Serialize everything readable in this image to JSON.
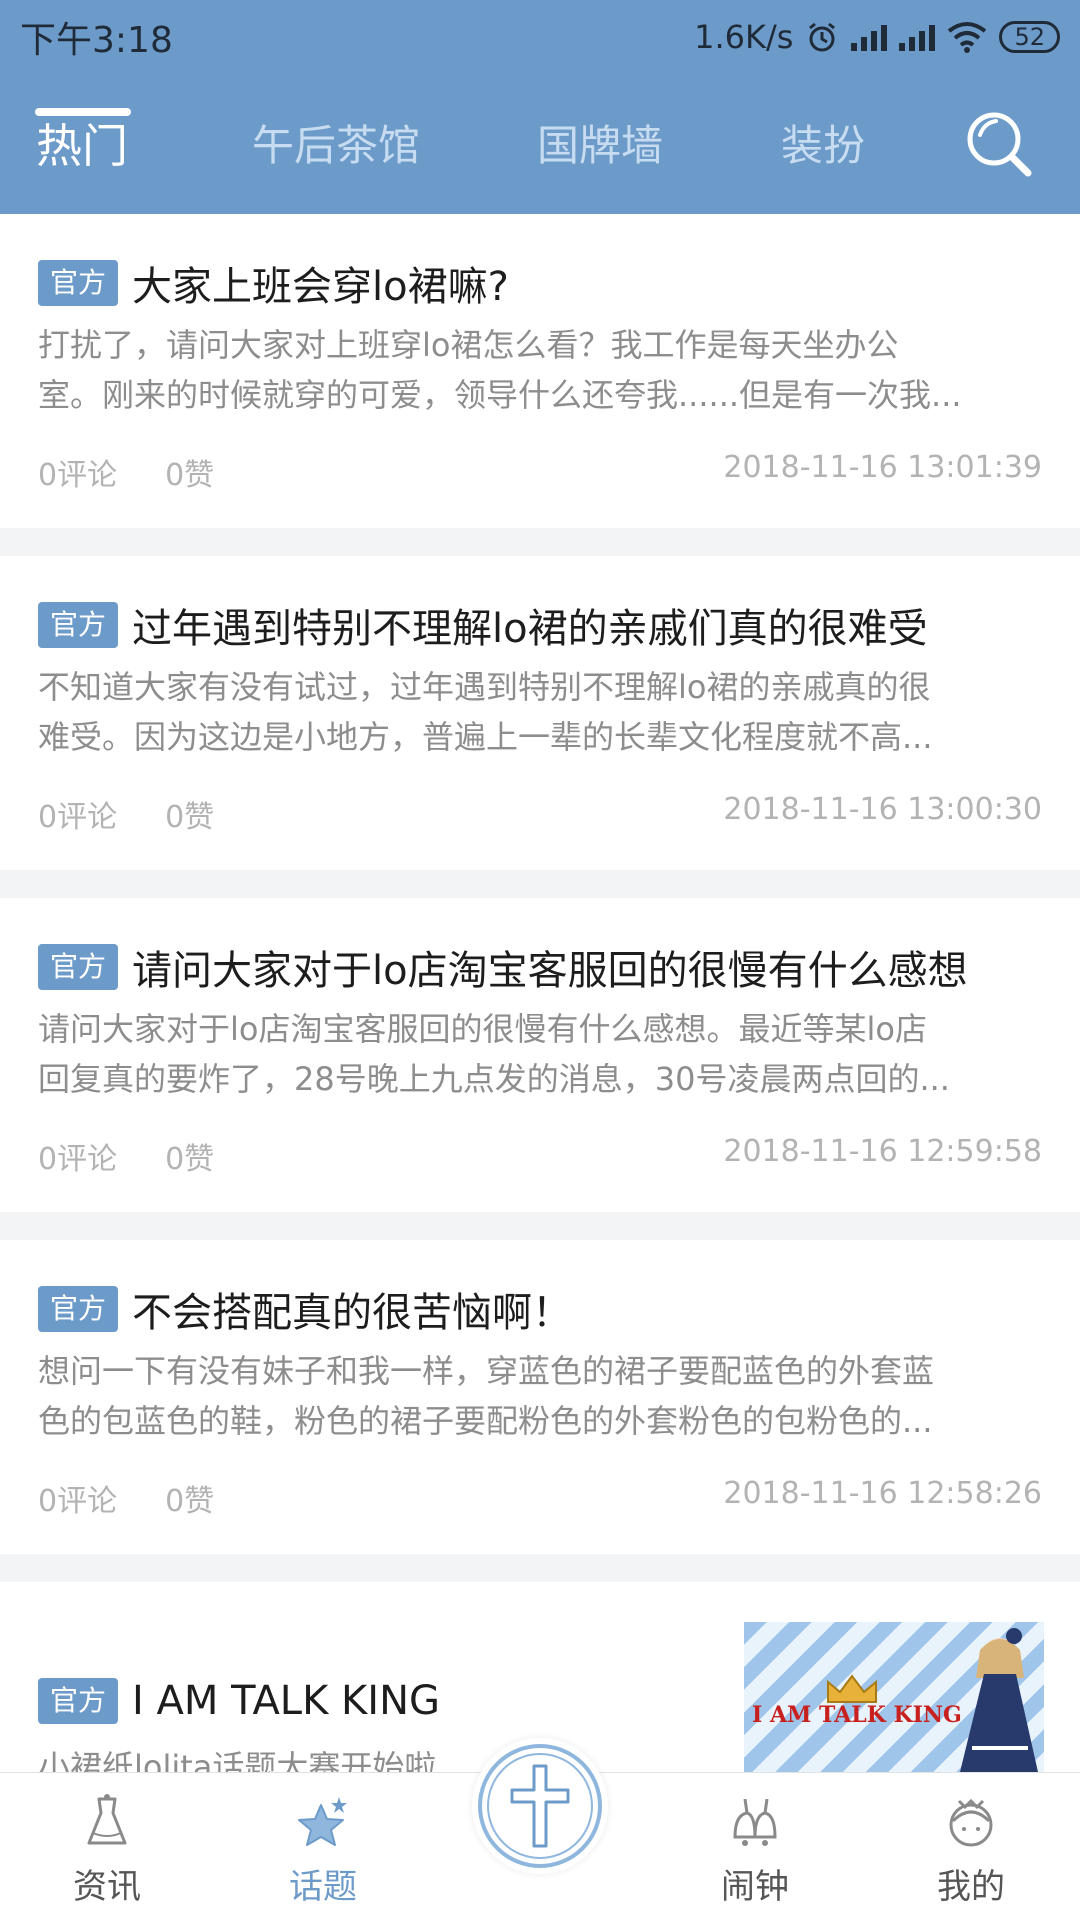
{
  "status_bar": {
    "time": "下午3:18",
    "network_speed": "1.6K/s",
    "battery": "52"
  },
  "tabs": [
    {
      "label": "热门",
      "active": true
    },
    {
      "label": "午后茶馆",
      "active": false
    },
    {
      "label": "国牌墙",
      "active": false
    },
    {
      "label": "装扮",
      "active": false
    }
  ],
  "posts": [
    {
      "badge": "官方",
      "title": "大家上班会穿lo裙嘛?",
      "excerpt_line1": "打扰了，请问大家对上班穿lo裙怎么看？我工作是每天坐办公",
      "excerpt_line2": "室。刚来的时候就穿的可爱，领导什么还夸我......但是有一次我...",
      "comments": "0评论",
      "likes": "0赞",
      "time": "2018-11-16 13:01:39"
    },
    {
      "badge": "官方",
      "title": "过年遇到特别不理解lo裙的亲戚们真的很难受",
      "excerpt_line1": "不知道大家有没有试过，过年遇到特别不理解lo裙的亲戚真的很",
      "excerpt_line2": "难受。因为这边是小地方，普遍上一辈的长辈文化程度就不高...",
      "comments": "0评论",
      "likes": "0赞",
      "time": "2018-11-16 13:00:30"
    },
    {
      "badge": "官方",
      "title": "请问大家对于lo店淘宝客服回的很慢有什么感想",
      "excerpt_line1": "请问大家对于lo店淘宝客服回的很慢有什么感想。最近等某lo店",
      "excerpt_line2": "回复真的要炸了，28号晚上九点发的消息，30号凌晨两点回的...",
      "comments": "0评论",
      "likes": "0赞",
      "time": "2018-11-16 12:59:58"
    },
    {
      "badge": "官方",
      "title": "不会搭配真的很苦恼啊！",
      "excerpt_line1": "想问一下有没有妹子和我一样，穿蓝色的裙子要配蓝色的外套蓝",
      "excerpt_line2": "色的包蓝色的鞋，粉色的裙子要配粉色的外套粉色的包粉色的...",
      "comments": "0评论",
      "likes": "0赞",
      "time": "2018-11-16 12:58:26"
    },
    {
      "badge": "官方",
      "title": "I AM TALK KING",
      "excerpt_line1": "小裙纸lolita话题大赛开始啦",
      "thumb_text": "I AM TALK KING"
    }
  ],
  "bottom_nav": [
    {
      "label": "资讯",
      "icon": "dress-icon",
      "active": false
    },
    {
      "label": "话题",
      "icon": "stars-icon",
      "active": true
    },
    {
      "label": "",
      "icon": "cross-icon",
      "active": false
    },
    {
      "label": "闹钟",
      "icon": "bells-icon",
      "active": false
    },
    {
      "label": "我的",
      "icon": "girl-face-icon",
      "active": false
    }
  ],
  "colors": {
    "accent": "#6d9bc9",
    "meta_gray": "#b3b3b3"
  }
}
